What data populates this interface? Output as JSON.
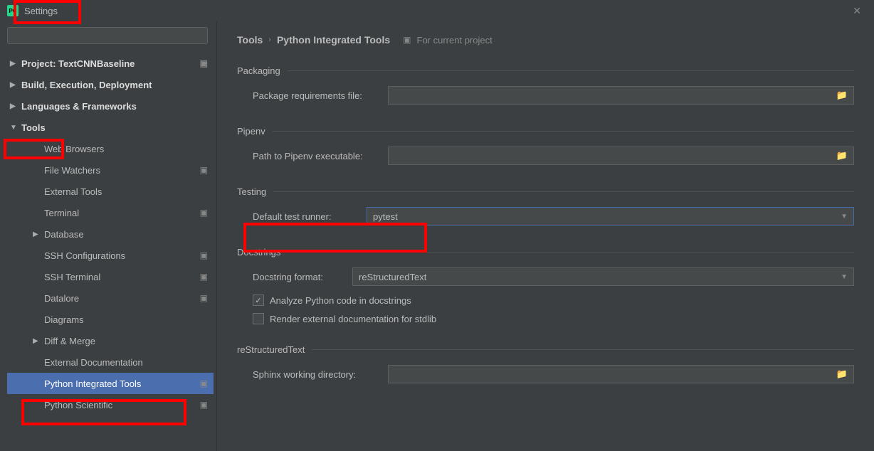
{
  "window": {
    "title": "Settings"
  },
  "search": {
    "placeholder": ""
  },
  "sidebar": {
    "items": [
      {
        "label": "Project: TextCNNBaseline",
        "arrow": "▶",
        "bold": true,
        "gear": true,
        "indent": 0
      },
      {
        "label": "Build, Execution, Deployment",
        "arrow": "▶",
        "bold": true,
        "gear": false,
        "indent": 0
      },
      {
        "label": "Languages & Frameworks",
        "arrow": "▶",
        "bold": true,
        "gear": false,
        "indent": 0
      },
      {
        "label": "Tools",
        "arrow": "▼",
        "bold": true,
        "gear": false,
        "indent": 0
      },
      {
        "label": "Web Browsers",
        "arrow": "",
        "bold": false,
        "gear": false,
        "indent": 1
      },
      {
        "label": "File Watchers",
        "arrow": "",
        "bold": false,
        "gear": true,
        "indent": 1
      },
      {
        "label": "External Tools",
        "arrow": "",
        "bold": false,
        "gear": false,
        "indent": 1
      },
      {
        "label": "Terminal",
        "arrow": "",
        "bold": false,
        "gear": true,
        "indent": 1
      },
      {
        "label": "Database",
        "arrow": "▶",
        "bold": false,
        "gear": false,
        "indent": 1
      },
      {
        "label": "SSH Configurations",
        "arrow": "",
        "bold": false,
        "gear": true,
        "indent": 1
      },
      {
        "label": "SSH Terminal",
        "arrow": "",
        "bold": false,
        "gear": true,
        "indent": 1
      },
      {
        "label": "Datalore",
        "arrow": "",
        "bold": false,
        "gear": true,
        "indent": 1
      },
      {
        "label": "Diagrams",
        "arrow": "",
        "bold": false,
        "gear": false,
        "indent": 1
      },
      {
        "label": "Diff & Merge",
        "arrow": "▶",
        "bold": false,
        "gear": false,
        "indent": 1
      },
      {
        "label": "External Documentation",
        "arrow": "",
        "bold": false,
        "gear": false,
        "indent": 1
      },
      {
        "label": "Python Integrated Tools",
        "arrow": "",
        "bold": false,
        "gear": true,
        "indent": 1,
        "selected": true
      },
      {
        "label": "Python Scientific",
        "arrow": "",
        "bold": false,
        "gear": true,
        "indent": 1
      }
    ]
  },
  "breadcrumb": {
    "part1": "Tools",
    "part2": "Python Integrated Tools",
    "project_hint": "For current project"
  },
  "sections": {
    "packaging": {
      "title": "Packaging",
      "req_label": "Package requirements file:",
      "req_value": ""
    },
    "pipenv": {
      "title": "Pipenv",
      "path_label": "Path to Pipenv executable:",
      "path_value": ""
    },
    "testing": {
      "title": "Testing",
      "runner_label": "Default test runner:",
      "runner_value": "pytest"
    },
    "docstrings": {
      "title": "Docstrings",
      "format_label": "Docstring format:",
      "format_value": "reStructuredText",
      "check_analyze": "Analyze Python code in docstrings",
      "check_render": "Render external documentation for stdlib"
    },
    "rst": {
      "title": "reStructuredText",
      "sphinx_label": "Sphinx working directory:",
      "sphinx_value": ""
    }
  }
}
